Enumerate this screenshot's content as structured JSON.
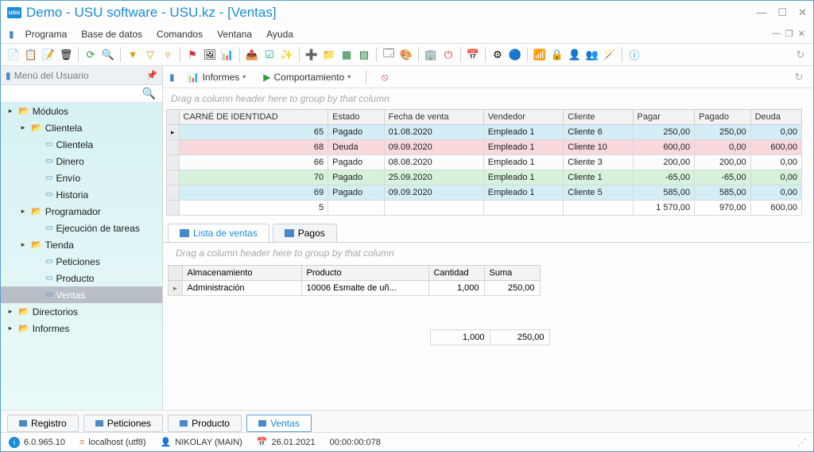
{
  "title": "Demo - USU software - USU.kz - [Ventas]",
  "app_icon": "usu",
  "menu": [
    "Programa",
    "Base de datos",
    "Comandos",
    "Ventana",
    "Ayuda"
  ],
  "sidebar": {
    "title": "Menú del Usuario",
    "tree": [
      {
        "type": "folder",
        "label": "Módulos",
        "level": 0,
        "expand": "▸"
      },
      {
        "type": "folder",
        "label": "Clientela",
        "level": 1,
        "expand": "▸"
      },
      {
        "type": "doc",
        "label": "Clientela",
        "level": 2
      },
      {
        "type": "doc",
        "label": "Dinero",
        "level": 2
      },
      {
        "type": "doc",
        "label": "Envío",
        "level": 2
      },
      {
        "type": "doc",
        "label": "Historia",
        "level": 2
      },
      {
        "type": "folder",
        "label": "Programador",
        "level": 1,
        "expand": "▸"
      },
      {
        "type": "doc",
        "label": "Ejecución de tareas",
        "level": 2
      },
      {
        "type": "folder",
        "label": "Tienda",
        "level": 1,
        "expand": "▸"
      },
      {
        "type": "doc",
        "label": "Peticiones",
        "level": 2
      },
      {
        "type": "doc",
        "label": "Producto",
        "level": 2
      },
      {
        "type": "doc",
        "label": "Ventas",
        "level": 2,
        "selected": true
      },
      {
        "type": "folder",
        "label": "Directorios",
        "level": 0,
        "expand": "▸"
      },
      {
        "type": "folder",
        "label": "Informes",
        "level": 0,
        "expand": "▸"
      }
    ]
  },
  "subtoolbar": {
    "informes": "Informes",
    "comport": "Comportamiento"
  },
  "group_hint": "Drag a column header here to group by that column",
  "grid": {
    "headers": [
      "CARNÉ DE IDENTIDAD",
      "Estado",
      "Fecha de venta",
      "Vendedor",
      "Cliente",
      "Pagar",
      "Pagado",
      "Deuda"
    ],
    "rows": [
      {
        "cls": "blue",
        "cells": [
          "65",
          "Pagado",
          "01.08.2020",
          "Empleado 1",
          "Cliente 6",
          "250,00",
          "250,00",
          "0,00"
        ],
        "ind": "▸"
      },
      {
        "cls": "pink",
        "cells": [
          "68",
          "Deuda",
          "09.09.2020",
          "Empleado 1",
          "Cliente 10",
          "600,00",
          "0,00",
          "600,00"
        ]
      },
      {
        "cls": "white",
        "cells": [
          "66",
          "Pagado",
          "08.08.2020",
          "Empleado 1",
          "Cliente 3",
          "200,00",
          "200,00",
          "0,00"
        ]
      },
      {
        "cls": "green",
        "cells": [
          "70",
          "Pagado",
          "25.09.2020",
          "Empleado 1",
          "Cliente 1",
          "-65,00",
          "-65,00",
          "0,00"
        ]
      },
      {
        "cls": "blue",
        "cells": [
          "69",
          "Pagado",
          "09.09.2020",
          "Empleado 1",
          "Cliente 5",
          "585,00",
          "585,00",
          "0,00"
        ]
      }
    ],
    "sums": {
      "count": "5",
      "pagar": "1 570,00",
      "pagado": "970,00",
      "deuda": "600,00"
    }
  },
  "inner_tabs": [
    {
      "label": "Lista de ventas",
      "active": true
    },
    {
      "label": "Pagos",
      "active": false
    }
  ],
  "detail_grid": {
    "headers": [
      "Almacenamiento",
      "Producto",
      "Cantidad",
      "Suma"
    ],
    "row": [
      "Administración",
      "10006 Esmalte de uñ...",
      "1,000",
      "250,00"
    ],
    "sums": {
      "cant": "1,000",
      "suma": "250,00"
    }
  },
  "footer_tabs": [
    {
      "label": "Registro"
    },
    {
      "label": "Peticiones"
    },
    {
      "label": "Producto"
    },
    {
      "label": "Ventas",
      "active": true
    }
  ],
  "status": {
    "version": "6.0.965.10",
    "host": "localhost (utf8)",
    "user": "NIKOLAY (MAIN)",
    "date": "26.01.2021",
    "time": "00:00:00:078"
  }
}
